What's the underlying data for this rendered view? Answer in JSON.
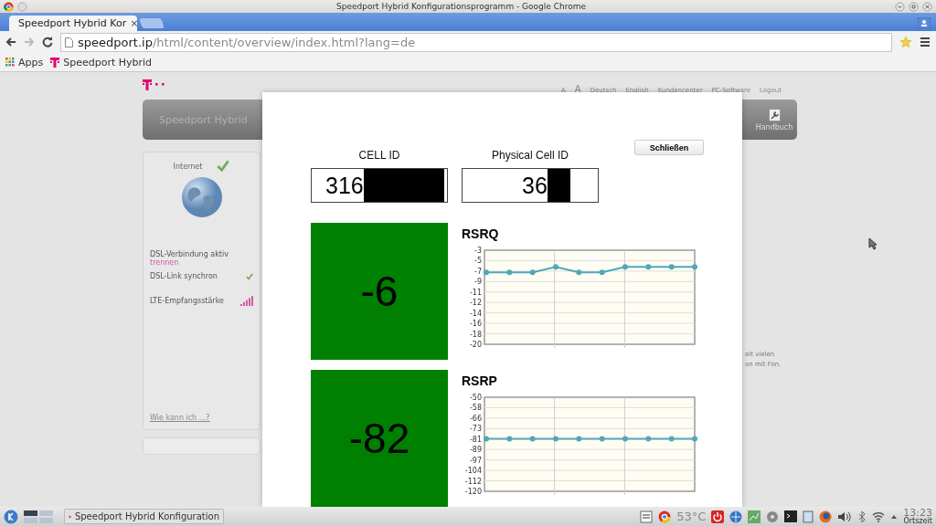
{
  "window": {
    "title": "Speedport Hybrid Konfigurationsprogramm - Google Chrome"
  },
  "tabs": [
    {
      "label": "Speedport Hybrid Kor",
      "close": "×",
      "selected": true
    }
  ],
  "address_bar": {
    "host": "speedport.ip",
    "path": "/html/content/overview/index.html?lang=de"
  },
  "bookmarks": [
    "Apps",
    "Speedport Hybrid"
  ],
  "top_links": [
    "A",
    "A",
    "Deutsch",
    "English",
    "Kundencenter",
    "PC-Software",
    "Logout"
  ],
  "header": {
    "title": "Speedport Hybrid",
    "manual": "Handbuch"
  },
  "status_card": {
    "title": "Internet",
    "items": [
      {
        "kind": "link",
        "label": "DSL-Verbindung aktiv",
        "action": "trennen"
      },
      {
        "kind": "check",
        "label": "DSL-Link synchron"
      },
      {
        "kind": "signal",
        "label": "LTE-Empfangsstärke"
      }
    ],
    "help": "Wie kann ich ...?"
  },
  "background_text": [
    "eit vielen",
    "on mit Fon."
  ],
  "dialog": {
    "close": "Schließen",
    "ids": [
      {
        "label": "CELL ID",
        "value": "316"
      },
      {
        "label": "Physical Cell ID",
        "value": "36"
      }
    ],
    "metrics": [
      {
        "value": "-6",
        "chart_data": {
          "type": "line",
          "title": "RSRQ",
          "ylim": [
            -20,
            -3
          ],
          "grid": true,
          "yticks": [
            -3,
            {
              "value": -4.89,
              "label": "-5"
            },
            {
              "value": -6.78,
              "label": "-7"
            },
            {
              "value": -8.67,
              "label": "-9"
            },
            {
              "value": -10.56,
              "label": "-11"
            },
            {
              "value": -12.44,
              "label": "-12"
            },
            {
              "value": -14.33,
              "label": "-14"
            },
            {
              "value": -16.22,
              "label": "-16"
            },
            {
              "value": -18.11,
              "label": "-18"
            },
            -20
          ],
          "series": [
            {
              "color": "#4fa8b8",
              "marker": "circle",
              "values": [
                -7,
                -7,
                -7,
                -6,
                -7,
                -7,
                -6,
                -6,
                -6,
                -6
              ]
            }
          ]
        }
      },
      {
        "value": "-82",
        "chart_data": {
          "type": "line",
          "title": "RSRP",
          "ylim": [
            -120,
            -50
          ],
          "grid": true,
          "yticks": [
            -50,
            {
              "value": -57.78,
              "label": "-58"
            },
            {
              "value": -65.56,
              "label": "-66"
            },
            {
              "value": -73.33,
              "label": "-73"
            },
            {
              "value": -81.11,
              "label": "-81"
            },
            {
              "value": -88.89,
              "label": "-89"
            },
            {
              "value": -96.67,
              "label": "-97"
            },
            {
              "value": -104.44,
              "label": "-104"
            },
            {
              "value": -112.22,
              "label": "-112"
            },
            -120
          ],
          "series": [
            {
              "color": "#4fa8b8",
              "marker": "circle",
              "values": [
                -81,
                -81,
                -81,
                -81,
                -81,
                -81,
                -81,
                -81,
                -81,
                -81
              ]
            }
          ]
        }
      }
    ]
  },
  "taskbar": {
    "task": "Speedport Hybrid Konfiguration",
    "temperature": "53°C",
    "time": "13:23",
    "timezone": "Ortszeit"
  }
}
